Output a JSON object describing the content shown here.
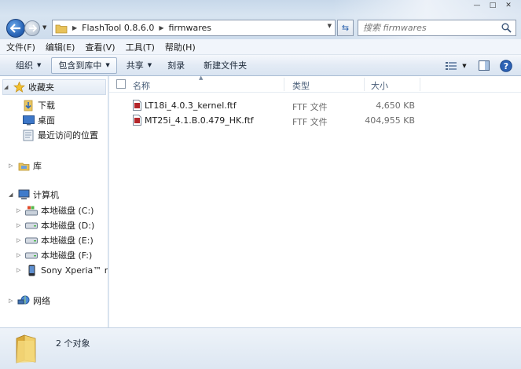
{
  "window": {
    "minimize": "—",
    "maximize": "□",
    "close": "✕"
  },
  "address": {
    "crumbs": [
      "FlashTool 0.8.6.0",
      "firmwares"
    ]
  },
  "search": {
    "placeholder": "搜索 firmwares"
  },
  "menu": [
    "文件(F)",
    "编辑(E)",
    "查看(V)",
    "工具(T)",
    "帮助(H)"
  ],
  "toolbar": {
    "organize": "组织",
    "include_library": "包含到库中",
    "share": "共享",
    "burn": "刻录",
    "new_folder": "新建文件夹"
  },
  "navpane": {
    "favorites": "收藏夹",
    "downloads": "下载",
    "desktop": "桌面",
    "recent": "最近访问的位置",
    "libraries": "库",
    "computer": "计算机",
    "drive_c": "本地磁盘 (C:)",
    "drive_d": "本地磁盘 (D:)",
    "drive_e": "本地磁盘 (E:)",
    "drive_f": "本地磁盘 (F:)",
    "phone": "Sony Xperia™ neo",
    "network": "网络"
  },
  "columns": {
    "name": "名称",
    "type": "类型",
    "size": "大小"
  },
  "files": [
    {
      "name": "LT18i_4.0.3_kernel.ftf",
      "type": "FTF 文件",
      "size": "4,650 KB"
    },
    {
      "name": "MT25i_4.1.B.0.479_HK.ftf",
      "type": "FTF 文件",
      "size": "404,955 KB"
    }
  ],
  "status": {
    "count": "2 个对象"
  },
  "colors": {
    "accent": "#2a66b8",
    "folder": "#e8c25a"
  }
}
